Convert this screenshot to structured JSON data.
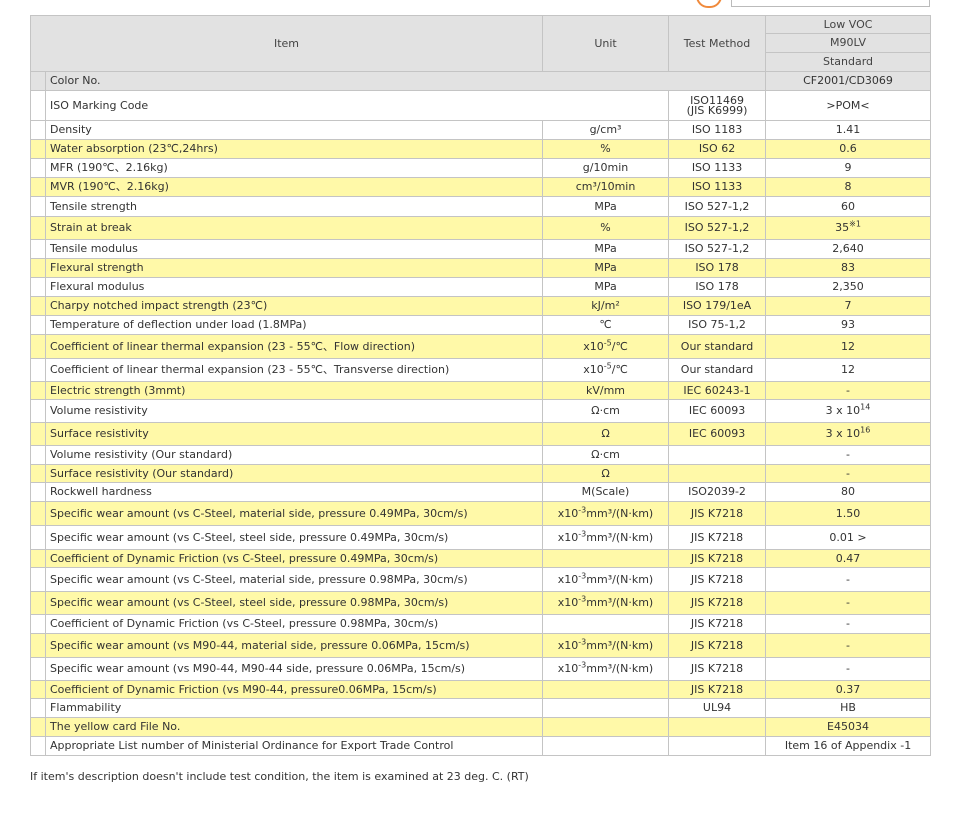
{
  "header": {
    "item": "Item",
    "unit": "Unit",
    "test_method": "Test Method",
    "grade_category": "Low VOC",
    "grade_name": "M90LV",
    "grade_type": "Standard"
  },
  "color_row": {
    "label": "Color No.",
    "value": "CF2001/CD3069"
  },
  "iso_row": {
    "label": "ISO Marking Code",
    "method_1": "ISO11469",
    "method_2": "(JIS K6999)",
    "value": ">POM<"
  },
  "rows": [
    {
      "label": "Density",
      "unit": "g/cm³",
      "method": "ISO 1183",
      "value": "1.41"
    },
    {
      "label": "Water absorption (23℃,24hrs)",
      "unit": "%",
      "method": "ISO 62",
      "value": "0.6"
    },
    {
      "label": "MFR (190℃、2.16kg)",
      "unit": "g/10min",
      "method": "ISO 1133",
      "value": "9"
    },
    {
      "label": "MVR (190℃、2.16kg)",
      "unit": "cm³/10min",
      "method": "ISO 1133",
      "value": "8"
    },
    {
      "label": "Tensile strength",
      "unit": "MPa",
      "method": "ISO 527-1,2",
      "value": "60"
    },
    {
      "label": "Strain at break",
      "unit": "%",
      "method": "ISO 527-1,2",
      "value": "35",
      "value_sup": "※1"
    },
    {
      "label": "Tensile modulus",
      "unit": "MPa",
      "method": "ISO 527-1,2",
      "value": "2,640"
    },
    {
      "label": "Flexural strength",
      "unit": "MPa",
      "method": "ISO 178",
      "value": "83"
    },
    {
      "label": "Flexural modulus",
      "unit": "MPa",
      "method": "ISO 178",
      "value": "2,350"
    },
    {
      "label": "Charpy notched impact strength (23℃)",
      "unit": "kJ/m²",
      "method": "ISO 179/1eA",
      "value": "7"
    },
    {
      "label": "Temperature of deflection under load (1.8MPa)",
      "unit": "℃",
      "method": "ISO 75-1,2",
      "value": "93"
    },
    {
      "label": "Coefficient of linear thermal expansion (23 - 55℃、Flow direction)",
      "unit_pre": "x10",
      "unit_sup": "-5",
      "unit_post": "/℃",
      "method": "Our standard",
      "value": "12"
    },
    {
      "label": "Coefficient of linear thermal expansion (23 - 55℃、Transverse direction)",
      "unit_pre": "x10",
      "unit_sup": "-5",
      "unit_post": "/℃",
      "method": "Our standard",
      "value": "12"
    },
    {
      "label": "Electric strength (3mmt)",
      "unit": "kV/mm",
      "method": "IEC 60243-1",
      "value": "-"
    },
    {
      "label": "Volume resistivity",
      "unit": "Ω·cm",
      "method": "IEC 60093",
      "value": "3 x 10",
      "value_sup": "14"
    },
    {
      "label": "Surface resistivity",
      "unit": "Ω",
      "method": "IEC 60093",
      "value": "3 x 10",
      "value_sup": "16"
    },
    {
      "label": "Volume resistivity (Our standard)",
      "unit": "Ω·cm",
      "method": "",
      "value": "-"
    },
    {
      "label": "Surface resistivity (Our standard)",
      "unit": "Ω",
      "method": "",
      "value": "-"
    },
    {
      "label": "Rockwell hardness",
      "unit": "M(Scale)",
      "method": "ISO2039-2",
      "value": "80"
    },
    {
      "label": "Specific wear amount (vs C-Steel, material side, pressure 0.49MPa, 30cm/s)",
      "unit_pre": "x10",
      "unit_sup": "-3",
      "unit_post": "mm³/(N·km)",
      "method": "JIS K7218",
      "value": "1.50"
    },
    {
      "label": "Specific wear amount (vs C-Steel, steel side, pressure 0.49MPa, 30cm/s)",
      "unit_pre": "x10",
      "unit_sup": "-3",
      "unit_post": "mm³/(N·km)",
      "method": "JIS K7218",
      "value": "0.01 >"
    },
    {
      "label": "Coefficient of Dynamic Friction (vs C-Steel, pressure 0.49MPa, 30cm/s)",
      "unit": "",
      "method": "JIS K7218",
      "value": "0.47"
    },
    {
      "label": "Specific wear amount (vs C-Steel, material side, pressure 0.98MPa, 30cm/s)",
      "unit_pre": "x10",
      "unit_sup": "-3",
      "unit_post": "mm³/(N·km)",
      "method": "JIS K7218",
      "value": "-"
    },
    {
      "label": "Specific wear amount (vs C-Steel, steel side, pressure 0.98MPa, 30cm/s)",
      "unit_pre": "x10",
      "unit_sup": "-3",
      "unit_post": "mm³/(N·km)",
      "method": "JIS K7218",
      "value": "-"
    },
    {
      "label": "Coefficient of Dynamic Friction (vs C-Steel, pressure 0.98MPa, 30cm/s)",
      "unit": "",
      "method": "JIS K7218",
      "value": "-"
    },
    {
      "label": "Specific wear amount (vs M90-44, material side, pressure 0.06MPa, 15cm/s)",
      "unit_pre": "x10",
      "unit_sup": "-3",
      "unit_post": "mm³/(N·km)",
      "method": "JIS K7218",
      "value": "-"
    },
    {
      "label": "Specific wear amount (vs M90-44, M90-44 side, pressure 0.06MPa, 15cm/s)",
      "unit_pre": "x10",
      "unit_sup": "-3",
      "unit_post": "mm³/(N·km)",
      "method": "JIS K7218",
      "value": "-"
    },
    {
      "label": "Coefficient of Dynamic Friction (vs M90-44, pressure0.06MPa, 15cm/s)",
      "unit": "",
      "method": "JIS K7218",
      "value": "0.37"
    },
    {
      "label": "Flammability",
      "unit": "",
      "method": "UL94",
      "value": "HB"
    },
    {
      "label": "The yellow card File No.",
      "unit": "",
      "method": "",
      "value": "E45034"
    },
    {
      "label": "Appropriate List number of Ministerial Ordinance for Export Trade Control",
      "unit": "",
      "method": "",
      "value": "Item 16 of Appendix -1"
    }
  ],
  "footnote": "If item's description doesn't include test condition, the item is examined at 23 deg. C. (RT)"
}
